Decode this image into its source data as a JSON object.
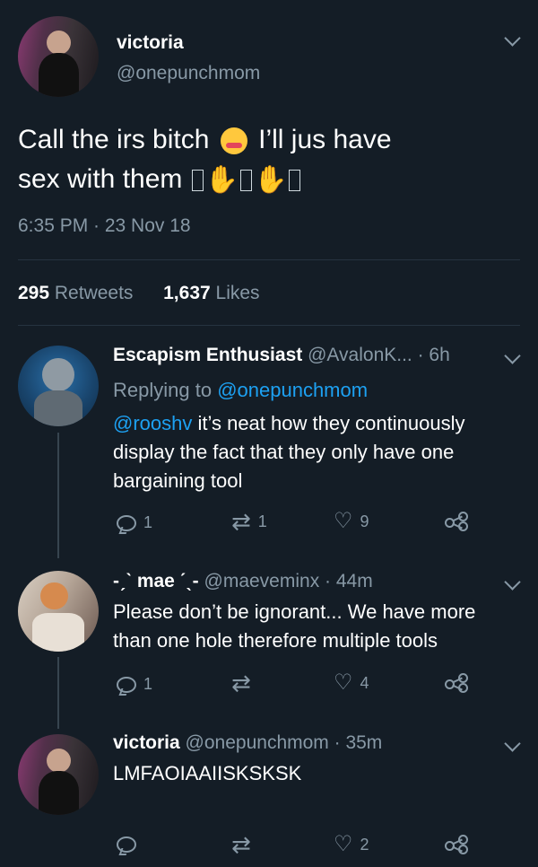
{
  "main_tweet": {
    "name": "victoria",
    "handle": "@onepunchmom",
    "text_line1": "Call the irs bitch",
    "text_line1b": "I’ll jus have",
    "text_line2": "sex with them",
    "emoji_names": [
      "woozy-face-icon",
      "clapping-hands-icon"
    ],
    "timestamp": "6:35 PM · 23 Nov 18",
    "retweets_count": "295",
    "retweets_label": "Retweets",
    "likes_count": "1,637",
    "likes_label": "Likes"
  },
  "replies": [
    {
      "name": "Escapism Enthusiast",
      "handle_time": "@AvalonK... · 6h",
      "replying_prefix": "Replying to",
      "replying_to": "@onepunchmom",
      "mention": "@rooshv",
      "text_first": " it’s neat how they continuously",
      "text_rest_1": "display the fact that they only have one",
      "text_rest_2": "bargaining tool",
      "reply_count": "1",
      "retweet_count": "1",
      "like_count": "9"
    },
    {
      "name": "-ˏˋ mae ˊˎ-",
      "handle_time": "@maeveminx · 44m",
      "text_1": "Please don’t be ignorant... We have more",
      "text_2": "than one hole therefore multiple tools",
      "reply_count": "1",
      "retweet_count": "",
      "like_count": "4"
    },
    {
      "name": "victoria",
      "handle_time": "@onepunchmom · 35m",
      "text_1": "LMFAOIAAIISKSKSK",
      "reply_count": "",
      "retweet_count": "",
      "like_count": "2"
    }
  ],
  "icons": {
    "reply": "reply-icon",
    "retweet": "retweet-icon",
    "like": "heart-icon",
    "share": "share-icon",
    "more": "chevron-down-icon"
  },
  "colors": {
    "background": "#141d26",
    "muted": "#8899a6",
    "link": "#1da1f2"
  }
}
